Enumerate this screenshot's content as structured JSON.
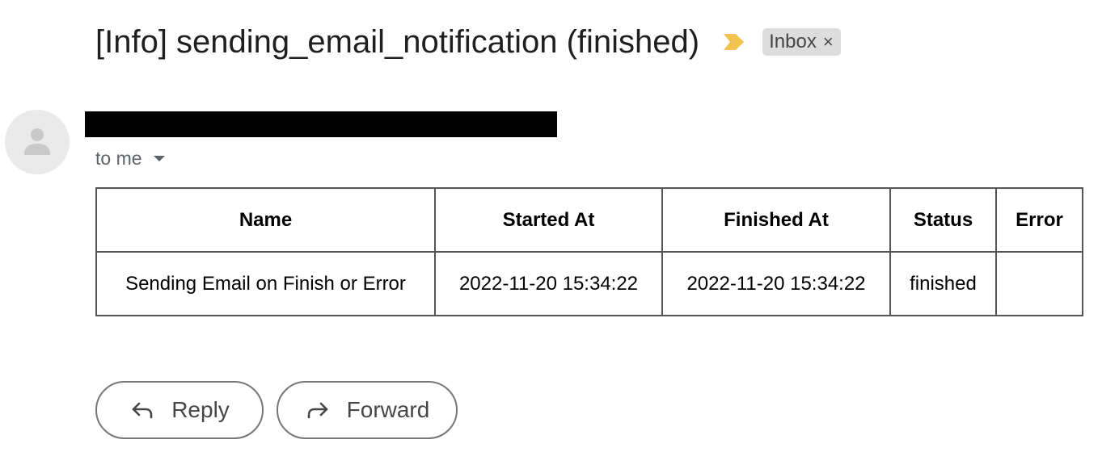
{
  "email": {
    "subject": "[Info] sending_email_notification (finished)",
    "label": "Inbox",
    "label_remove": "×",
    "recipient": "to me",
    "accent_color": "#f2c34e"
  },
  "table": {
    "headers": [
      "Name",
      "Started At",
      "Finished At",
      "Status",
      "Error"
    ],
    "rows": [
      {
        "name": "Sending Email on Finish or Error",
        "started_at": "2022-11-20 15:34:22",
        "finished_at": "2022-11-20 15:34:22",
        "status": "finished",
        "error": ""
      }
    ]
  },
  "actions": {
    "reply_label": "Reply",
    "forward_label": "Forward"
  },
  "icons": {
    "importance": "importance-marker-icon",
    "avatar": "person-icon",
    "reply": "reply-icon",
    "forward": "forward-icon",
    "caret": "caret-down-icon"
  }
}
